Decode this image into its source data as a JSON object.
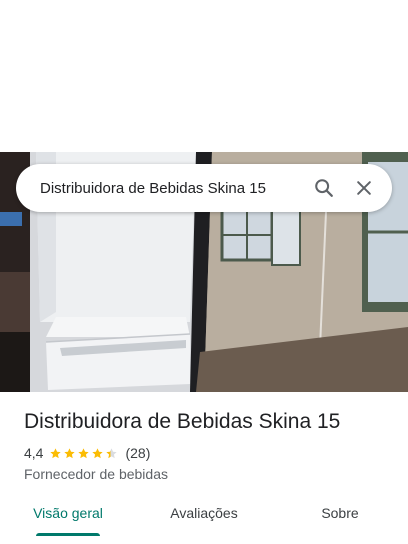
{
  "search": {
    "query": "Distribuidora de Bebidas Skina 15"
  },
  "place": {
    "title": "Distribuidora de Bebidas Skina 15",
    "rating": "4,4",
    "rating_fraction": 0.88,
    "review_count": "(28)",
    "category": "Fornecedor de bebidas"
  },
  "tabs": [
    {
      "label": "Visão geral",
      "active": true
    },
    {
      "label": "Avaliações",
      "active": false
    },
    {
      "label": "Sobre",
      "active": false
    }
  ],
  "colors": {
    "accent": "#00796b",
    "star": "#fbbc04"
  },
  "icons": {
    "search": "search-icon",
    "close": "close-icon",
    "star": "star-icon"
  }
}
